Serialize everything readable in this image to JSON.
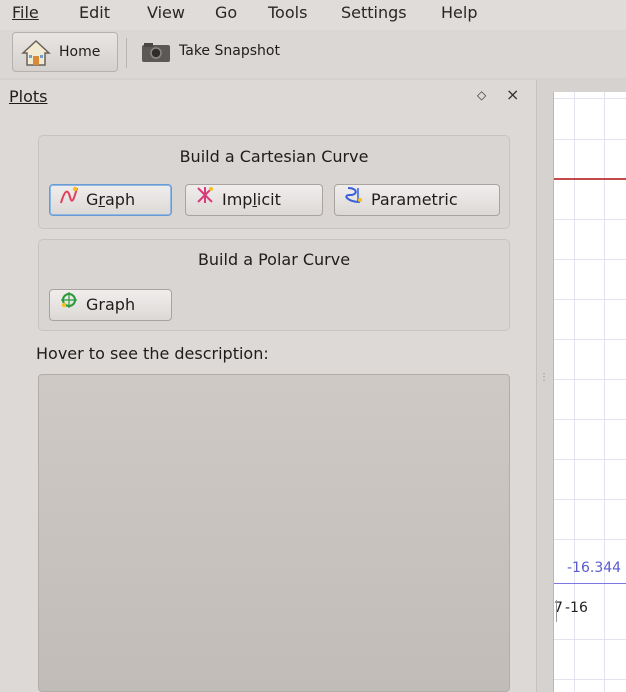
{
  "menu": {
    "items": [
      "File",
      "Edit",
      "View",
      "Go",
      "Tools",
      "Settings",
      "Help"
    ]
  },
  "toolbar": {
    "home_label": "Home",
    "home_icon": "home-icon",
    "snapshot_label": "Take Snapshot",
    "snapshot_icon": "camera-icon"
  },
  "dock": {
    "title": "Plots",
    "float_glyph": "◇",
    "close_glyph": "×",
    "cartesian": {
      "title": "Build a Cartesian Curve",
      "buttons": [
        {
          "label_pre": "G",
          "label_u": "r",
          "label_post": "aph",
          "icon": "function-graph-icon"
        },
        {
          "label_pre": "Imp",
          "label_u": "l",
          "label_post": "icit",
          "icon": "implicit-curve-icon"
        },
        {
          "label_pre": "Parametric",
          "label_u": "",
          "label_post": "",
          "icon": "parametric-curve-icon"
        }
      ]
    },
    "polar": {
      "title": "Build a Polar Curve",
      "buttons": [
        {
          "label_pre": "Graph",
          "label_u": "",
          "label_post": "",
          "icon": "polar-graph-icon"
        }
      ]
    },
    "hover_label": "Hover to see the description:"
  },
  "canvas": {
    "blue_value": "-16.344",
    "x_tick": "-16",
    "left_tick": "7"
  },
  "colors": {
    "curve": "#c44a4a",
    "highlight": "#5a5ad0",
    "accent": "#6b9bd1"
  }
}
